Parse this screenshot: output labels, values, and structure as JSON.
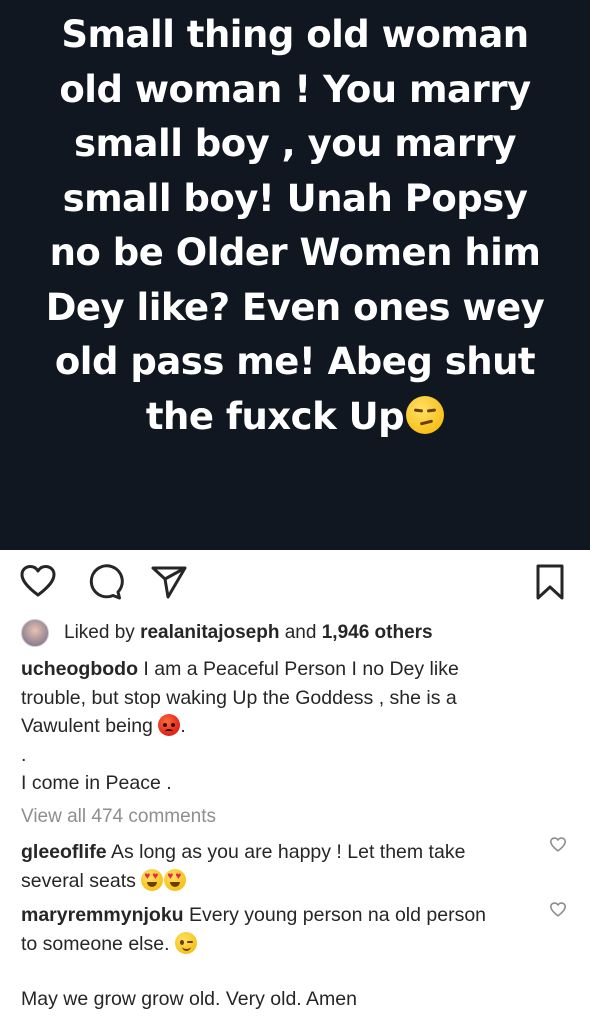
{
  "post_image": {
    "lines": [
      "Small thing old woman",
      "old woman ! You marry",
      "small boy , you marry",
      "small boy! Unah Popsy",
      "no be Older Women him",
      "Dey like? Even ones wey",
      "old pass me! Abeg shut",
      "the fuxck Up"
    ],
    "trailing_emoji": "smirking-face"
  },
  "actions": {
    "like_icon": "heart-icon",
    "comment_icon": "comment-icon",
    "share_icon": "send-icon",
    "save_icon": "bookmark-icon"
  },
  "likes": {
    "prefix": "Liked by",
    "user": "realanitajoseph",
    "conjunction": "and",
    "others": "1,946 others"
  },
  "caption": {
    "username": "ucheogbodo",
    "line1": " I am a Peaceful Person I no Dey like",
    "line2": "trouble, but stop waking Up the Goddess , she is a",
    "line3": "Vawulent being ",
    "line3_end": ".",
    "line4": ".",
    "line5": "I come in Peace ."
  },
  "view_all": "View all 474 comments",
  "comments": [
    {
      "username": "gleeoflife",
      "line1": " As long as you are happy ! Let them take",
      "line2": "several seats "
    },
    {
      "username": "maryremmynjoku",
      "line1": " Every young person na old person",
      "line2": "to someone else. "
    }
  ],
  "footer": "May we grow grow old. Very old. Amen",
  "colors": {
    "post_background": "#111720",
    "text": "#262626",
    "muted": "#8e8e8e"
  }
}
